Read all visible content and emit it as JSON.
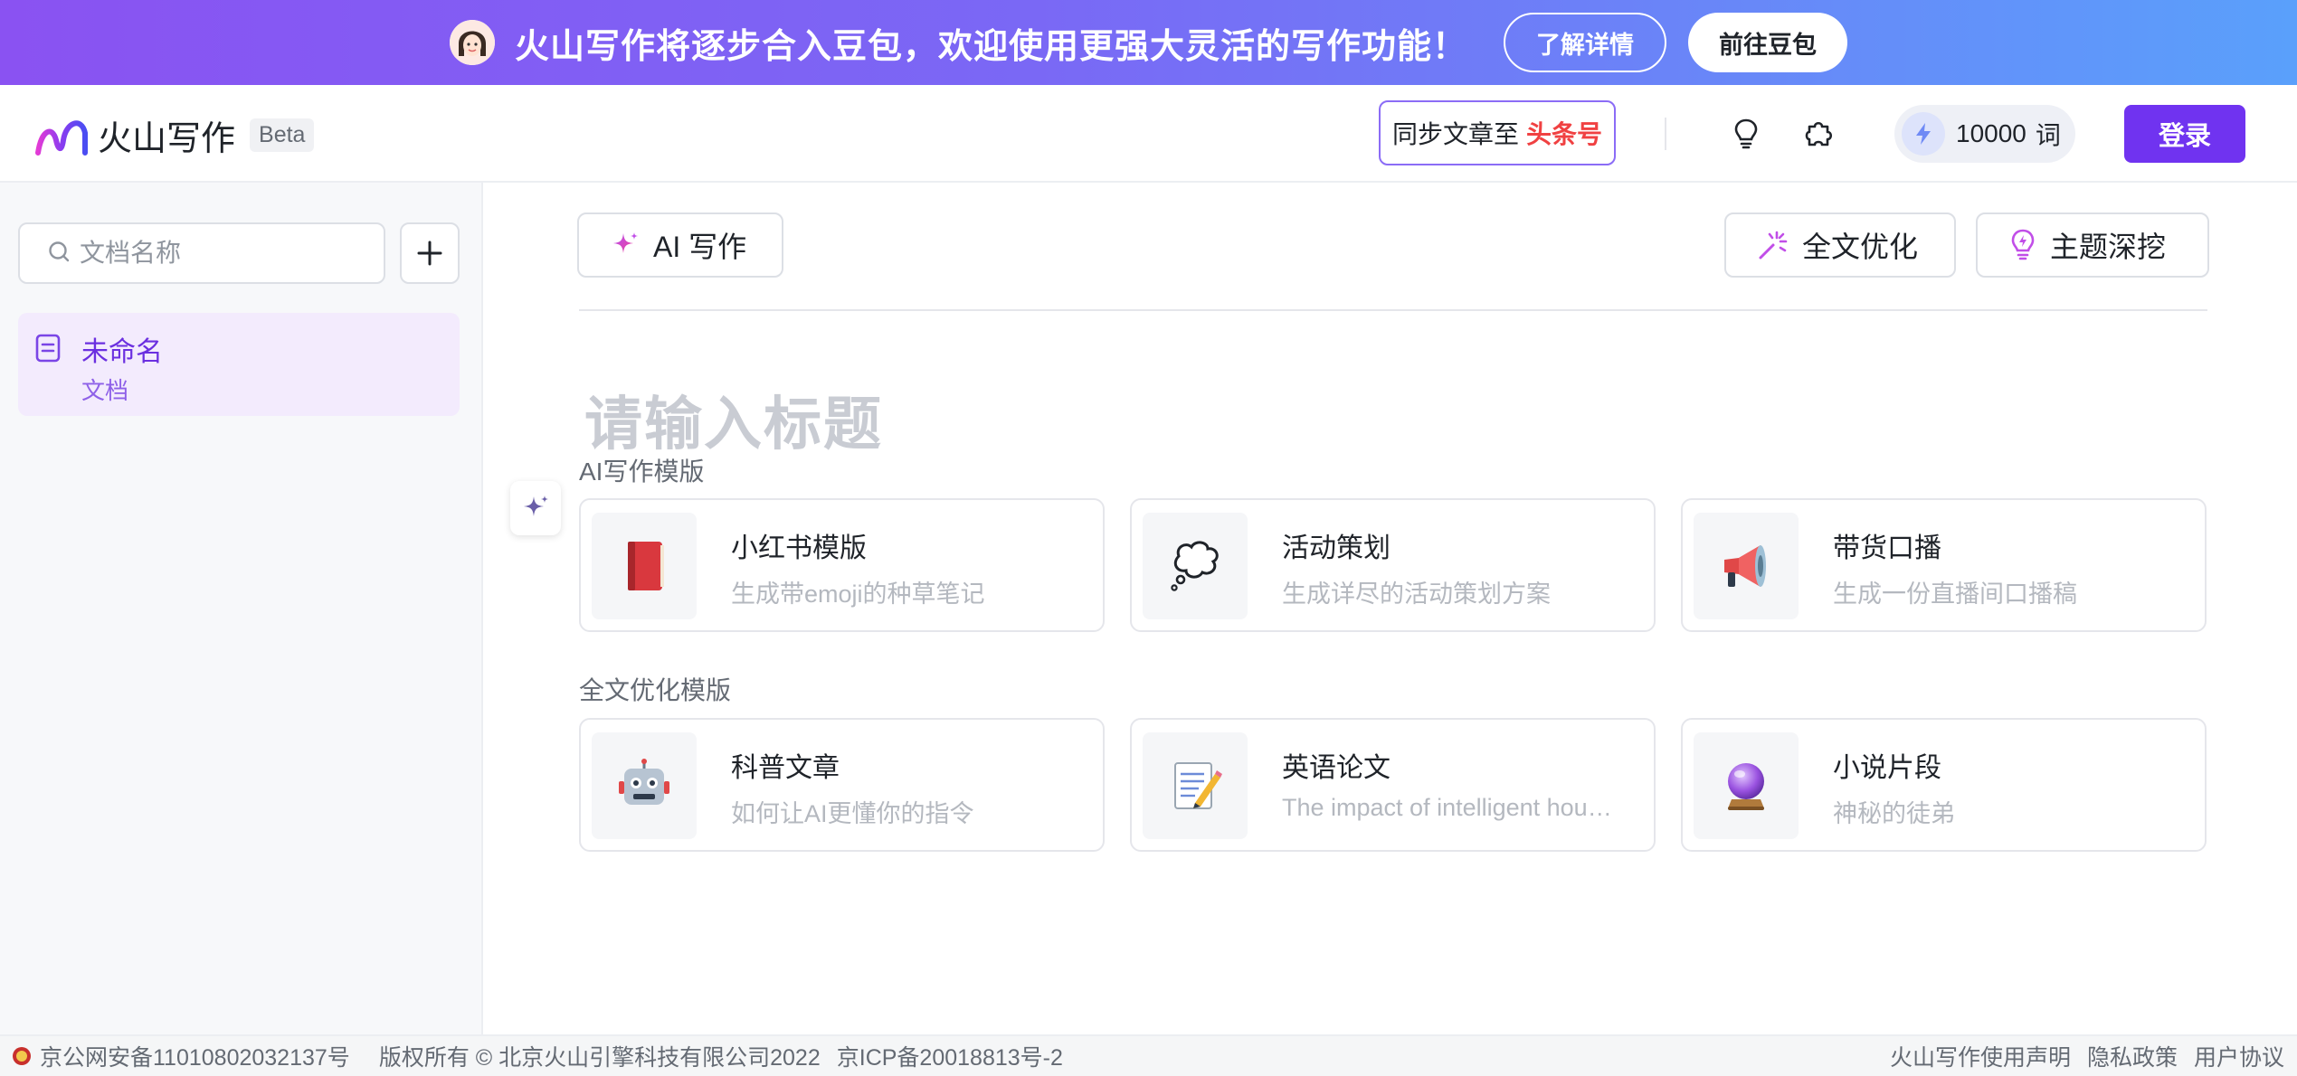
{
  "banner": {
    "text": "火山写作将逐步合入豆包，欢迎使用更强大灵活的写作功能！",
    "learn_more": "了解详情",
    "go_doubao": "前往豆包"
  },
  "header": {
    "logo_text": "火山写作",
    "beta": "Beta",
    "sync_prefix": "同步文章至",
    "sync_target": "头条号",
    "word_count": "10000",
    "word_unit": "词",
    "login": "登录"
  },
  "sidebar": {
    "search_placeholder": "文档名称",
    "documents": [
      {
        "title": "未命名",
        "subtitle": "文档"
      }
    ]
  },
  "toolbar": {
    "ai_write": "AI 写作",
    "full_optimize": "全文优化",
    "topic_dig": "主题深挖"
  },
  "editor": {
    "title_placeholder": "请输入标题"
  },
  "templates": {
    "ai_section_label": "AI写作模版",
    "ai_cards": [
      {
        "title": "小红书模版",
        "desc": "生成带emoji的种草笔记",
        "icon": "red-book-icon"
      },
      {
        "title": "活动策划",
        "desc": "生成详尽的活动策划方案",
        "icon": "thought-bubble-icon"
      },
      {
        "title": "带货口播",
        "desc": "生成一份直播间口播稿",
        "icon": "megaphone-icon"
      }
    ],
    "optimize_section_label": "全文优化模版",
    "optimize_cards": [
      {
        "title": "科普文章",
        "desc": "如何让AI更懂你的指令",
        "icon": "robot-icon"
      },
      {
        "title": "英语论文",
        "desc": "The impact of intelligent hou…",
        "icon": "memo-icon"
      },
      {
        "title": "小说片段",
        "desc": "神秘的徒弟",
        "icon": "crystal-ball-icon"
      }
    ]
  },
  "footer": {
    "police_record": "京公网安备11010802032137号",
    "copyright": "版权所有 © 北京火山引擎科技有限公司2022",
    "icp": "京ICP备20018813号-2",
    "statement": "火山写作使用声明",
    "privacy": "隐私政策",
    "agreement": "用户协议"
  },
  "colors": {
    "accent": "#7033f0",
    "banner_start": "#8a52f2",
    "banner_end": "#5aa0fb",
    "toutiao_red": "#f04142"
  }
}
